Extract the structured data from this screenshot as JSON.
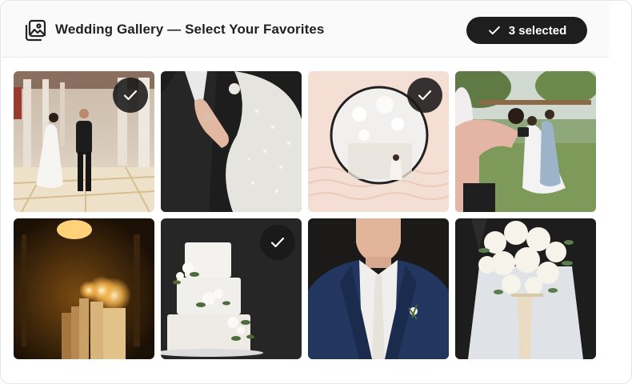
{
  "header": {
    "title": "Wedding Gallery — Select Your Favorites",
    "icon": "gallery-icon"
  },
  "selection": {
    "label": "3 selected",
    "icon": "check-icon"
  },
  "photos": [
    {
      "subject": "Bride and groom walking hand in hand through a columned hall",
      "selected": true
    },
    {
      "subject": "Bride's hand with ring on groom's tuxedo lapel",
      "selected": false
    },
    {
      "subject": "Bride reflected in a round mirror on a pink wall",
      "selected": true
    },
    {
      "subject": "Photographer shooting the bride and bridesmaid outdoors",
      "selected": false
    },
    {
      "subject": "Row of glowing candles in a dark room",
      "selected": false
    },
    {
      "subject": "Three-tier white wedding cake with flowers",
      "selected": true
    },
    {
      "subject": "Groom in navy suit with boutonniere",
      "selected": false
    },
    {
      "subject": "Bride holding a white rose bouquet",
      "selected": false
    }
  ],
  "colors": {
    "badge_bg": "#1e1e1e",
    "header_bg": "#fafafa",
    "check_bg": "#191919"
  }
}
